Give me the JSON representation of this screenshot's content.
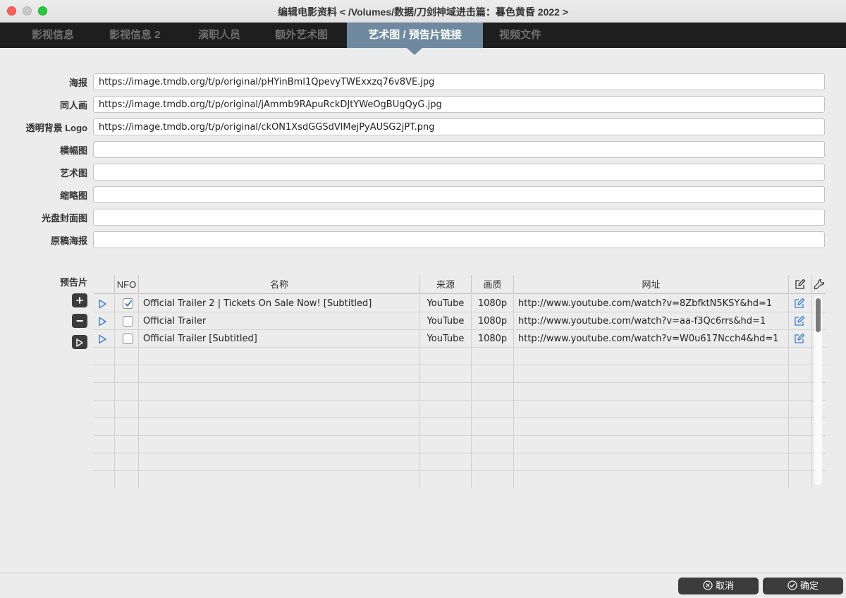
{
  "window": {
    "title": "编辑电影资料 < /Volumes/数据/刀剑神域进击篇：暮色黄昏 2022 >"
  },
  "tabs": [
    {
      "label": "影视信息"
    },
    {
      "label": "影视信息 2"
    },
    {
      "label": "演职人员"
    },
    {
      "label": "额外艺术图"
    },
    {
      "label": "艺术图 / 预告片链接"
    },
    {
      "label": "视频文件"
    }
  ],
  "active_tab": "艺术图 / 预告片链接",
  "fields": [
    {
      "label": "海报",
      "value": "https://image.tmdb.org/t/p/original/pHYinBml1QpevyTWExxzq76v8VE.jpg"
    },
    {
      "label": "同人画",
      "value": "https://image.tmdb.org/t/p/original/jAmmb9RApuRckDJtYWeOgBUgQyG.jpg"
    },
    {
      "label": "透明背景 Logo",
      "value": "https://image.tmdb.org/t/p/original/ckON1XsdGGSdVlMejPyAUSG2jPT.png"
    },
    {
      "label": "横幅图",
      "value": ""
    },
    {
      "label": "艺术图",
      "value": ""
    },
    {
      "label": "缩略图",
      "value": ""
    },
    {
      "label": "光盘封面图",
      "value": ""
    },
    {
      "label": "原稿海报",
      "value": ""
    }
  ],
  "trailers": {
    "label": "预告片",
    "side_buttons": {
      "add": "+",
      "remove": "−"
    },
    "columns": {
      "nfo": "NFO",
      "name": "名称",
      "source": "来源",
      "quality": "画质",
      "url": "网址"
    },
    "rows": [
      {
        "nfo": true,
        "name": "Official Trailer 2 | Tickets On Sale Now! [Subtitled]",
        "source": "YouTube",
        "quality": "1080p",
        "url": "http://www.youtube.com/watch?v=8ZbfktN5KSY&hd=1"
      },
      {
        "nfo": false,
        "name": "Official Trailer",
        "source": "YouTube",
        "quality": "1080p",
        "url": "http://www.youtube.com/watch?v=aa-f3Qc6rrs&hd=1"
      },
      {
        "nfo": false,
        "name": "Official Trailer [Subtitled]",
        "source": "YouTube",
        "quality": "1080p",
        "url": "http://www.youtube.com/watch?v=W0u617Ncch4&hd=1"
      }
    ]
  },
  "footer": {
    "cancel_label": "取消",
    "ok_label": "确定"
  },
  "colors": {
    "tab_bar": "#1e1e1e",
    "active_tab": "#6f8aa0",
    "play_icon": "#3a7bd5",
    "button": "#3c3c3c"
  }
}
